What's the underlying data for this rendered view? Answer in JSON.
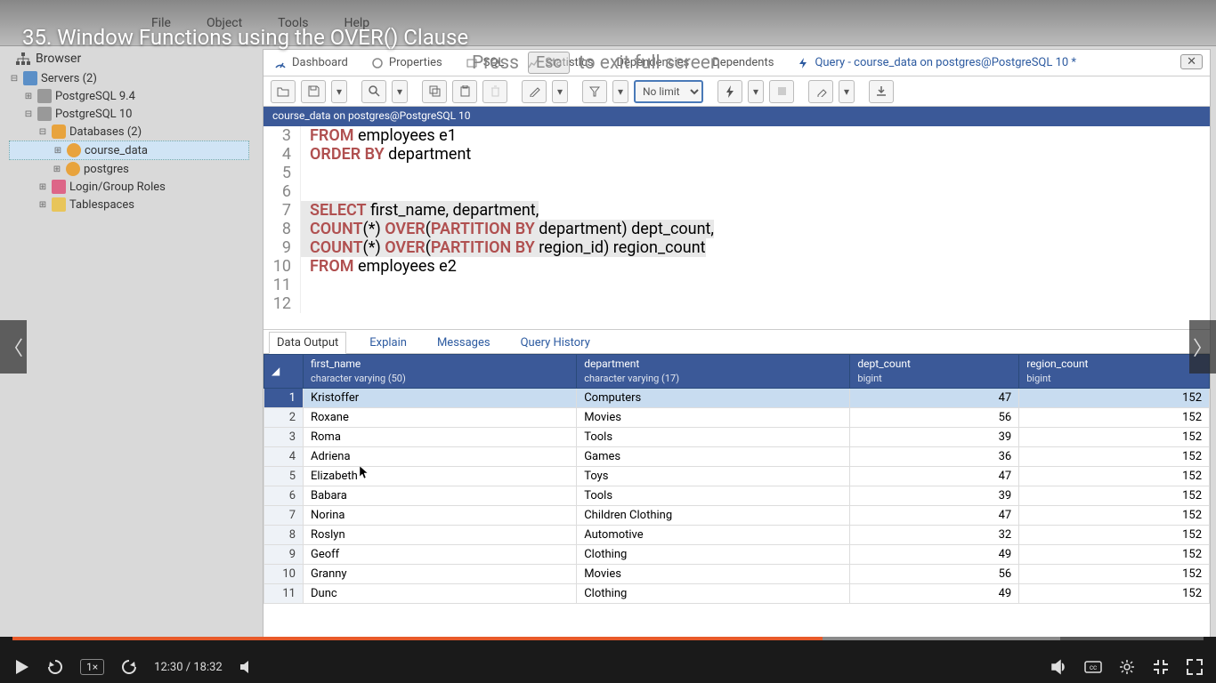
{
  "video_title": "35. Window Functions using the OVER() Clause",
  "overlay_hint_pre": "Press",
  "overlay_hint_key": "Esc",
  "overlay_hint_post": "to exit full screen",
  "app_name": "pgAdmin 4",
  "top_menu": {
    "file": "File",
    "object": "Object",
    "tools": "Tools",
    "help": "Help"
  },
  "browser_label": "Browser",
  "tree": {
    "servers": "Servers (2)",
    "pg94": "PostgreSQL 9.4",
    "pg10": "PostgreSQL 10",
    "databases": "Databases (2)",
    "db1": "course_data",
    "db2": "postgres",
    "login": "Login/Group Roles",
    "tablespaces": "Tablespaces"
  },
  "tabs": {
    "dashboard": "Dashboard",
    "properties": "Properties",
    "sql": "SQL",
    "statistics": "Statistics",
    "dependencies": "Dependencies",
    "dependents": "Dependents",
    "query": "Query - course_data on postgres@PostgreSQL 10 *"
  },
  "toolbar": {
    "limit": "No limit"
  },
  "connection_bar": "course_data on postgres@PostgreSQL 10",
  "sql": {
    "l3": {
      "kw": "FROM",
      "rest": " employees e1"
    },
    "l4": {
      "kw": "ORDER BY",
      "rest": " department"
    },
    "l7": {
      "kw": "SELECT",
      "rest": " first_name, department,"
    },
    "l8a": "COUNT",
    "l8b": "(*) ",
    "l8c": "OVER",
    "l8d": "(",
    "l8e": "PARTITION BY",
    "l8f": " department) dept_count,",
    "l9a": "COUNT",
    "l9b": "(*) ",
    "l9c": "OVER",
    "l9d": "(",
    "l9e": "PARTITION BY",
    "l9f": " region_id) region_count",
    "l10": {
      "kw": "FROM",
      "rest": " employees e2"
    }
  },
  "result_tabs": {
    "output": "Data Output",
    "explain": "Explain",
    "messages": "Messages",
    "history": "Query History"
  },
  "columns": [
    {
      "name": "first_name",
      "type": "character varying (50)"
    },
    {
      "name": "department",
      "type": "character varying (17)"
    },
    {
      "name": "dept_count",
      "type": "bigint"
    },
    {
      "name": "region_count",
      "type": "bigint"
    }
  ],
  "rows": [
    {
      "n": 1,
      "first_name": "Kristoffer",
      "department": "Computers",
      "dept_count": 47,
      "region_count": 152
    },
    {
      "n": 2,
      "first_name": "Roxane",
      "department": "Movies",
      "dept_count": 56,
      "region_count": 152
    },
    {
      "n": 3,
      "first_name": "Roma",
      "department": "Tools",
      "dept_count": 39,
      "region_count": 152
    },
    {
      "n": 4,
      "first_name": "Adriena",
      "department": "Games",
      "dept_count": 36,
      "region_count": 152
    },
    {
      "n": 5,
      "first_name": "Elizabeth",
      "department": "Toys",
      "dept_count": 47,
      "region_count": 152
    },
    {
      "n": 6,
      "first_name": "Babara",
      "department": "Tools",
      "dept_count": 39,
      "region_count": 152
    },
    {
      "n": 7,
      "first_name": "Norina",
      "department": "Children Clothing",
      "dept_count": 47,
      "region_count": 152
    },
    {
      "n": 8,
      "first_name": "Roslyn",
      "department": "Automotive",
      "dept_count": 32,
      "region_count": 152
    },
    {
      "n": 9,
      "first_name": "Geoff",
      "department": "Clothing",
      "dept_count": 49,
      "region_count": 152
    },
    {
      "n": 10,
      "first_name": "Granny",
      "department": "Movies",
      "dept_count": 56,
      "region_count": 152
    },
    {
      "n": 11,
      "first_name": "Dunc",
      "department": "Clothing",
      "dept_count": 49,
      "region_count": 152
    }
  ],
  "player": {
    "time": "12:30 / 18:32",
    "speed": "1×"
  }
}
